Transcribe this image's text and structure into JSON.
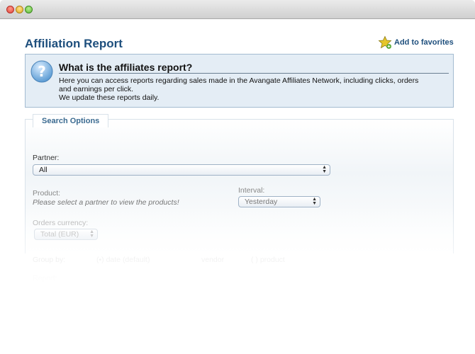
{
  "window": {
    "controls": [
      "close",
      "minimize",
      "zoom"
    ]
  },
  "header": {
    "title": "Affiliation Report",
    "favorites_label": "Add to favorites"
  },
  "info": {
    "heading": "What is the affiliates report?",
    "line1": "Here you can access reports regarding sales made in the Avangate Affiliates Network, including clicks, orders",
    "line2": "and earnings per click.",
    "line3": "We update these reports daily."
  },
  "search": {
    "legend": "Search Options",
    "partner_label": "Partner:",
    "partner_value": "All",
    "product_label": "Product:",
    "product_hint": "Please select a partner to view the products!",
    "interval_label": "Interval:",
    "interval_value": "Yesterday",
    "currency_label": "Orders currency:",
    "currency_value": "Total (EUR)",
    "group_label": "Group by:",
    "group_options": [
      "(•) date (default)",
      "vendor",
      "( ) product"
    ],
    "more_label": "Report:"
  },
  "colors": {
    "accent": "#1e4f7d",
    "info_bg": "#e4edf5",
    "info_border": "#a3bbd1"
  }
}
